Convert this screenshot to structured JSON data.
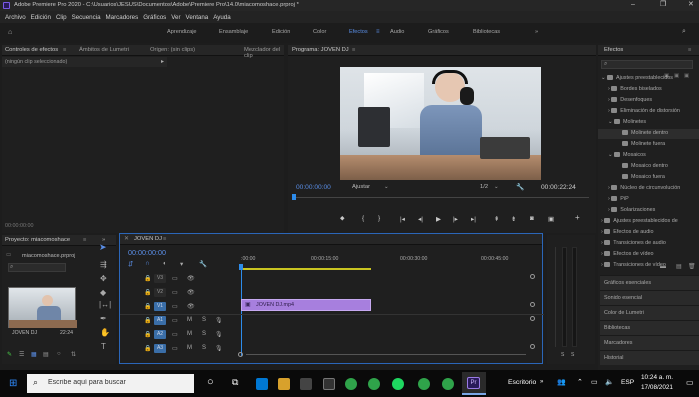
{
  "window": {
    "title": "Adobe Premiere Pro 2020 - C:\\Usuarios\\JESUS\\Documentos\\Adobe\\Premiere Pro\\14.0\\miacomoshace.prproj *"
  },
  "menu": [
    "Archivo",
    "Edición",
    "Clip",
    "Secuencia",
    "Marcadores",
    "Gráficos",
    "Ver",
    "Ventana",
    "Ayuda"
  ],
  "workspaces": {
    "items": [
      "Aprendizaje",
      "Ensamblaje",
      "Edición",
      "Color",
      "Efectos",
      "Audio",
      "Gráficos",
      "Bibliotecas"
    ],
    "active": "Efectos",
    "more": "»"
  },
  "source_panel": {
    "tabs": [
      "Controles de efectos",
      "Ámbitos de Lumetri",
      "Origen: (sin clips)",
      "Mezclador del clip"
    ],
    "no_clip": "(ningún clip seleccionado)",
    "timecode": "00:00:00:00"
  },
  "program": {
    "title": "Programa: JOVEN DJ",
    "timecode": "00:00:00:00",
    "fit": "Ajustar",
    "ratio": "1/2",
    "duration": "00:00:22:24"
  },
  "project": {
    "title": "Proyecto: miacomoshace",
    "file": "miacomoshace.prproj",
    "clip_name": "JOVEN DJ",
    "clip_duration": "22:24"
  },
  "timeline": {
    "title": "JOVEN DJ",
    "timecode": "00:00:00:00",
    "ruler": [
      ":00:00",
      "00:00:15:00",
      "00:00:30:00",
      "00:00:45:00"
    ],
    "video_tracks": [
      "V3",
      "V2",
      "V1"
    ],
    "audio_tracks": [
      "A1",
      "A2",
      "A3"
    ],
    "clip": "JOVEN DJ.mp4",
    "mute": "M",
    "solo": "S"
  },
  "meter": {
    "labels": [
      "S",
      "S"
    ]
  },
  "effects": {
    "title": "Efectos",
    "items": [
      {
        "label": "Ajustes preestablecidos",
        "level": 0
      },
      {
        "label": "Bordes biselados",
        "level": 1
      },
      {
        "label": "Desenfoques",
        "level": 1
      },
      {
        "label": "Eliminación de distorsión",
        "level": 1
      },
      {
        "label": "Molinetes",
        "level": 1
      },
      {
        "label": "Molinete dentro",
        "level": 2
      },
      {
        "label": "Molinete fuera",
        "level": 2
      },
      {
        "label": "Mosaicos",
        "level": 1
      },
      {
        "label": "Mosaico dentro",
        "level": 2
      },
      {
        "label": "Mosaico fuera",
        "level": 2
      },
      {
        "label": "Núcleo de circunvolución",
        "level": 1
      },
      {
        "label": "PiP",
        "level": 1
      },
      {
        "label": "Solarizaciones",
        "level": 1
      },
      {
        "label": "Ajustes preestablecidos de",
        "level": 0
      },
      {
        "label": "Efectos de audio",
        "level": 0
      },
      {
        "label": "Transiciones de audio",
        "level": 0
      },
      {
        "label": "Efectos de vídeo",
        "level": 0
      },
      {
        "label": "Transiciones de vídeo",
        "level": 0
      }
    ],
    "panels": [
      "Gráficos esenciales",
      "Sonido esencial",
      "Color de Lumetri",
      "Bibliotecas",
      "Marcadores",
      "Historial"
    ]
  },
  "taskbar": {
    "search_placeholder": "Escribe aquí para buscar",
    "desktop": "Escritorio",
    "lang": "ESP",
    "time": "10:24 a. m.",
    "date": "17/08/2021"
  },
  "colors": {
    "accent": "#5a8ee6",
    "playhead": "#2d8ceb",
    "clip": "#a77fde",
    "track_on": "#3a6ea8"
  }
}
